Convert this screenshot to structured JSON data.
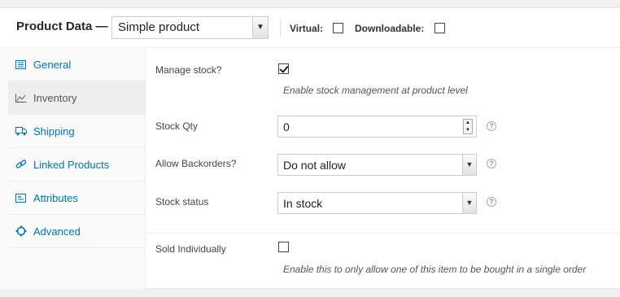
{
  "header": {
    "title": "Product Data —",
    "product_type": "Simple product",
    "virtual_label": "Virtual:",
    "virtual_checked": false,
    "downloadable_label": "Downloadable:",
    "downloadable_checked": false
  },
  "sidebar": {
    "items": [
      {
        "label": "General",
        "icon": "general-icon",
        "active": false
      },
      {
        "label": "Inventory",
        "icon": "inventory-icon",
        "active": true
      },
      {
        "label": "Shipping",
        "icon": "truck-icon",
        "active": false
      },
      {
        "label": "Linked Products",
        "icon": "link-icon",
        "active": false
      },
      {
        "label": "Attributes",
        "icon": "attributes-icon",
        "active": false
      },
      {
        "label": "Advanced",
        "icon": "gear-icon",
        "active": false
      }
    ]
  },
  "inventory": {
    "manage_stock_label": "Manage stock?",
    "manage_stock_checked": true,
    "manage_stock_desc": "Enable stock management at product level",
    "stock_qty_label": "Stock Qty",
    "stock_qty_value": "0",
    "backorders_label": "Allow Backorders?",
    "backorders_value": "Do not allow",
    "stock_status_label": "Stock status",
    "stock_status_value": "In stock",
    "sold_individually_label": "Sold Individually",
    "sold_individually_checked": false,
    "sold_individually_desc": "Enable this to only allow one of this item to be bought in a single order"
  },
  "colors": {
    "link": "#0073aa",
    "active_tab_bg": "#eeeeee",
    "sidebar_bg": "#fafafa"
  }
}
